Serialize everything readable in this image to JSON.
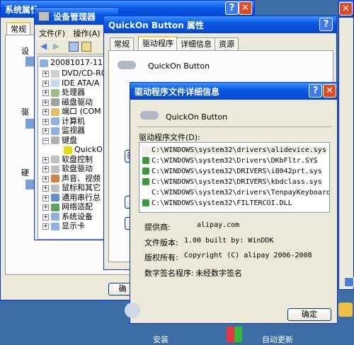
{
  "system_window": {
    "title": "系统属性",
    "tab_general": "常规",
    "label_1": "设",
    "label_2": "驱",
    "label_3": "硬",
    "ok_label": "确"
  },
  "device_manager": {
    "title": "设备管理器",
    "menu": {
      "file": "文件(F)",
      "action": "操作(A)"
    },
    "tree_root": "20081017-115",
    "tree_items": [
      "DVD/CD-RO",
      "IDE ATA/A",
      "处理器",
      "磁盘驱动",
      "端口 (COM",
      "计算机",
      "监视器",
      "键盘",
      "QuickO",
      "软盘控制",
      "软盘驱动",
      "声音、视频",
      "鼠标和其它",
      "通用串行总",
      "网络适配",
      "系统设备",
      "显示卡"
    ]
  },
  "props_window": {
    "title": "QuickOn Button 属性",
    "tabs": [
      "常规",
      "驱动程序",
      "详细信息",
      "资源"
    ],
    "device_name": "QuickOn Button",
    "side_btn": "驱"
  },
  "details_dialog": {
    "title": "驱动程序文件详细信息",
    "device_name": "QuickOn Button",
    "files_label": "驱动程序文件(D):",
    "files": [
      "C:\\WINDOWS\\system32\\drivers\\alidevice.sys",
      "C:\\WINDOWS\\system32\\Drivers\\DKbFltr.SYS",
      "C:\\WINDOWS\\system32\\DRIVERS\\i8042prt.sys",
      "C:\\WINDOWS\\system32\\DRIVERS\\kbdclass.sys",
      "C:\\WINDOWS\\system32\\drivers\\TenpayKeyboard.sys",
      "C:\\WINDOWS\\system32\\FILTERCOI.DLL"
    ],
    "provider_label": "提供商:",
    "provider_value": "alipay.com",
    "version_label": "文件版本:",
    "version_value": "1.00 built by: WinDDK",
    "copyright_label": "版权所有:",
    "copyright_value": "Copyright (C) alipay 2006-2008",
    "signer_label": "数字签名程序:",
    "signer_value": "未经数字签名",
    "ok_label": "确定"
  },
  "bottom": {
    "security_label": "安装",
    "update_label": "自动更新"
  }
}
